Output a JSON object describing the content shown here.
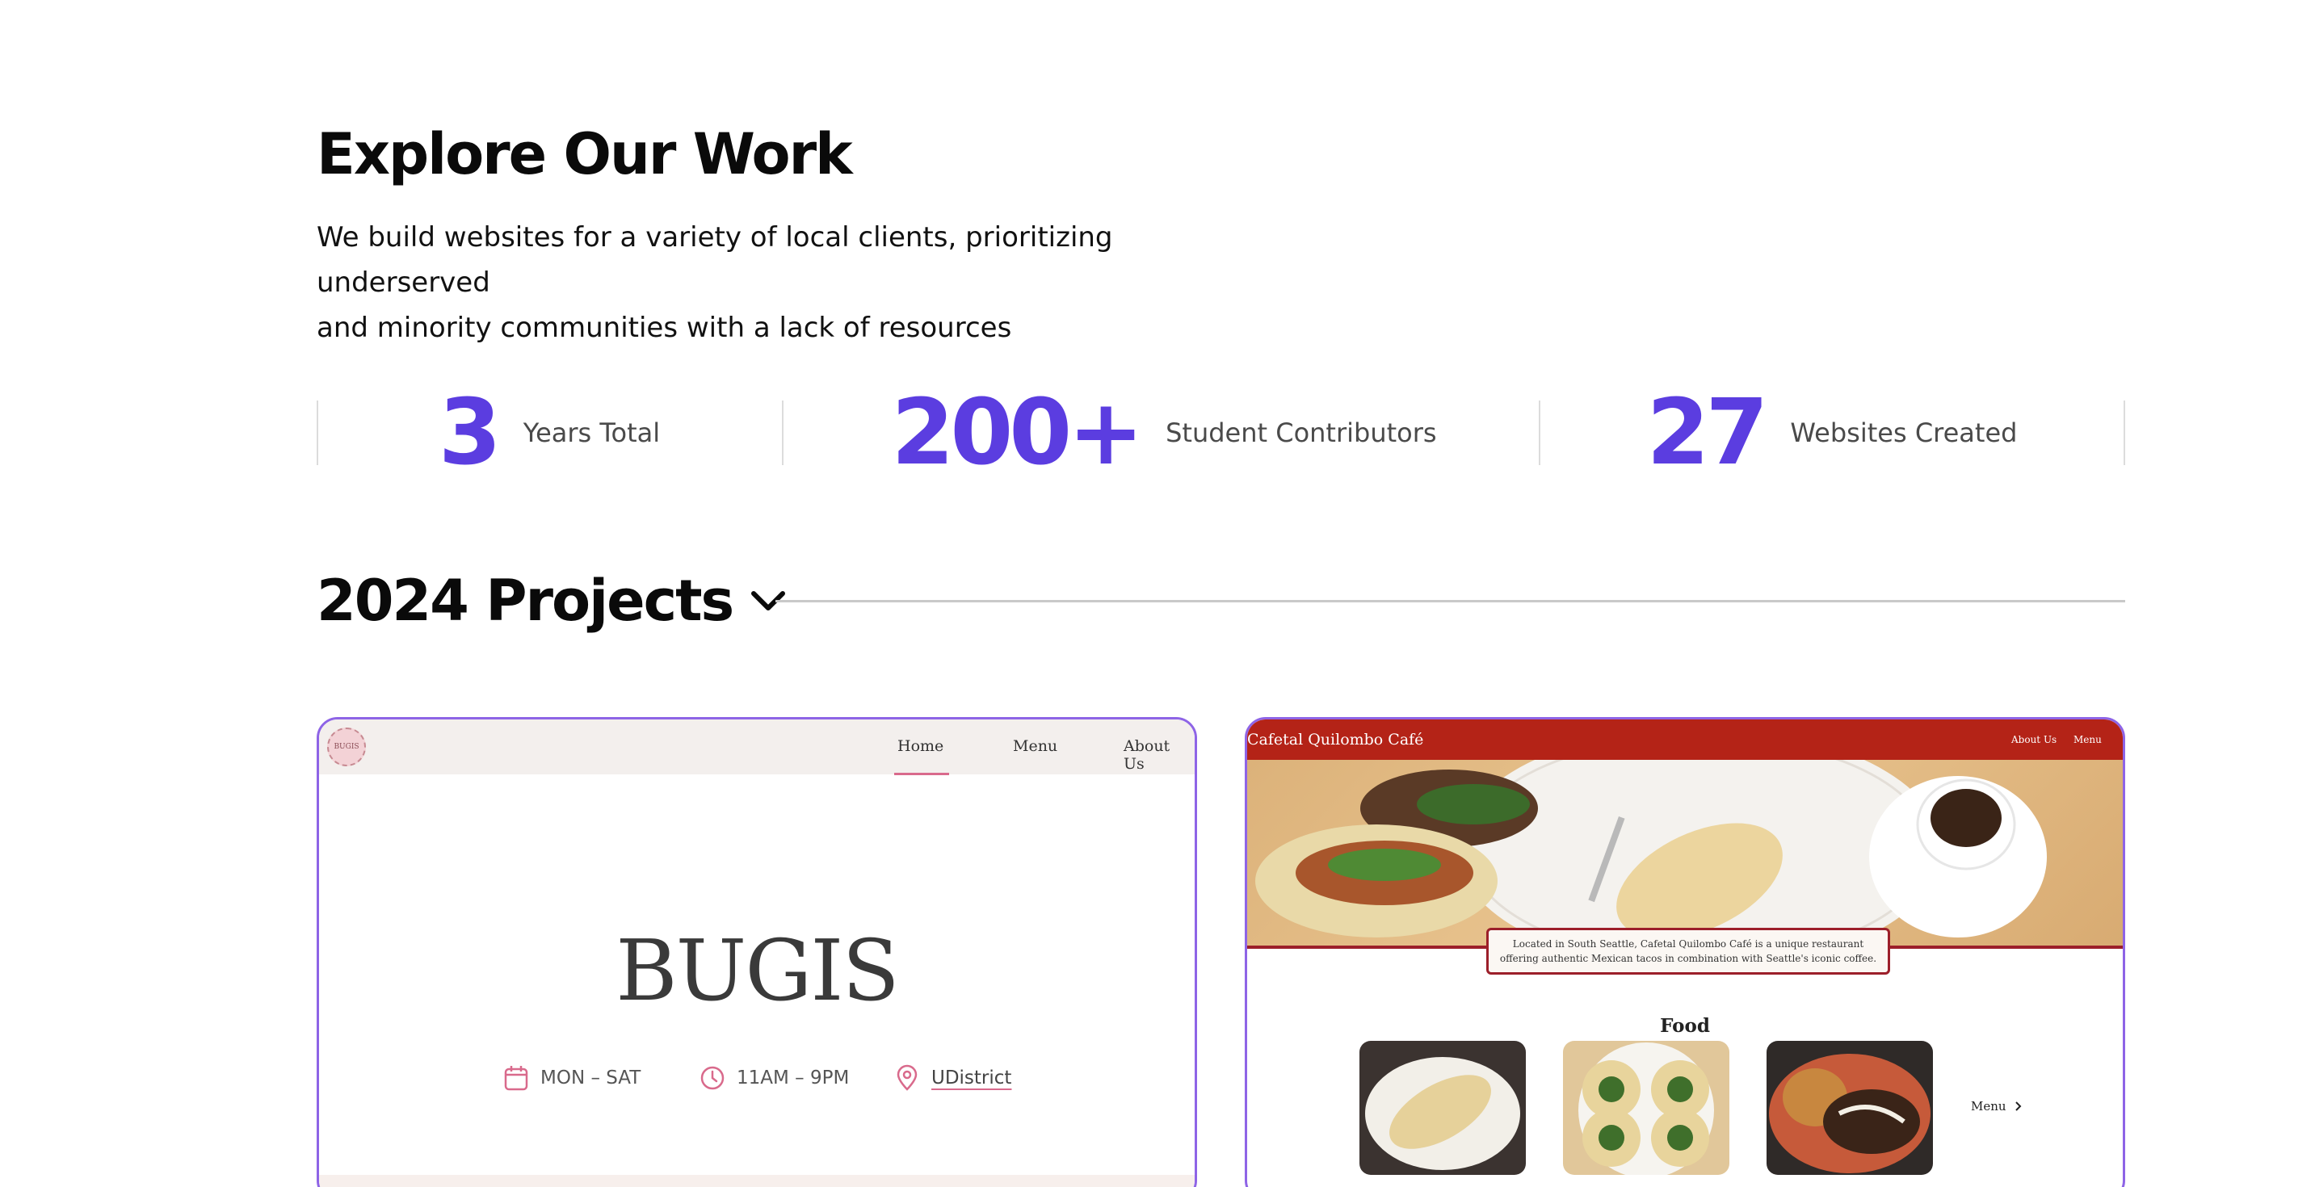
{
  "header": {
    "title": "Explore Our Work",
    "description_line1": "We build websites for a variety of local clients, prioritizing underserved",
    "description_line2": "and minority communities with a lack of resources"
  },
  "stats": [
    {
      "value": "3",
      "label": "Years Total"
    },
    {
      "value": "200+",
      "label": "Student Contributors"
    },
    {
      "value": "27",
      "label": "Websites Created"
    }
  ],
  "section": {
    "title": "2024 Projects",
    "toggle_icon": "chevron-down-icon"
  },
  "projects": [
    {
      "logo_text": "BUGIS",
      "nav": [
        "Home",
        "Menu",
        "About Us"
      ],
      "title": "BUGIS",
      "days": "MON – SAT",
      "hours": "11AM – 9PM",
      "location": "UDistrict",
      "accent_color": "#d96a8c"
    },
    {
      "brand": "Cafetal Quilombo Café",
      "nav": [
        "About Us",
        "Menu"
      ],
      "caption_line1": "Located in South Seattle, Cafetal Quilombo Café is a unique restaurant",
      "caption_line2": "offering authentic Mexican tacos in combination with Seattle's iconic coffee.",
      "food_heading": "Food",
      "menu_link": "Menu",
      "bar_color": "#b42317"
    }
  ],
  "colors": {
    "accent": "#5b3de0",
    "card_border": "#8e64e6"
  }
}
